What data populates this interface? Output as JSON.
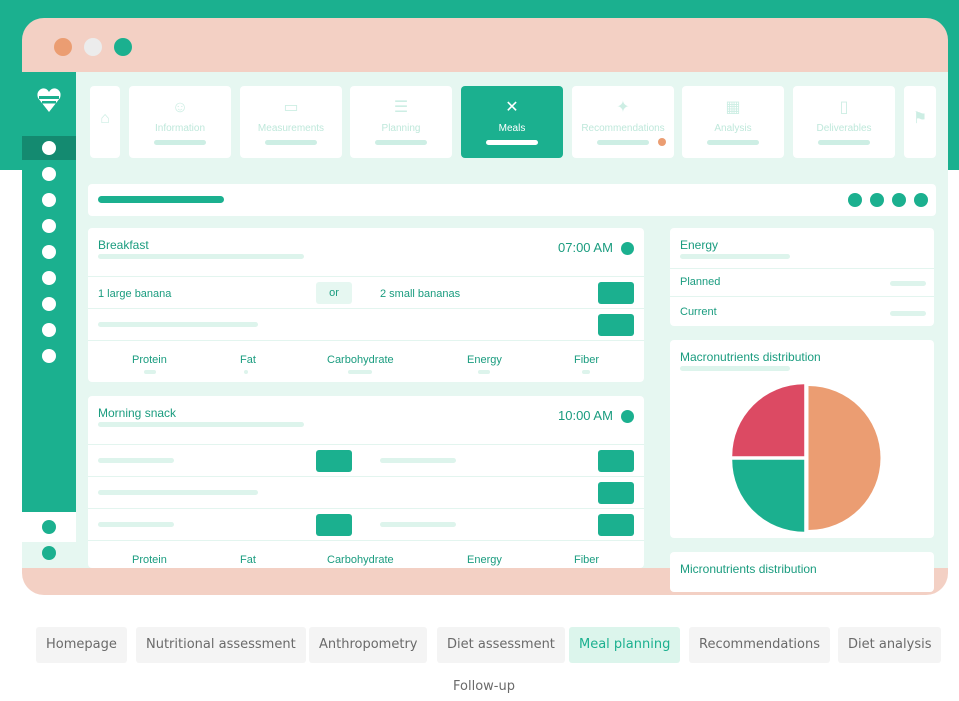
{
  "colors": {
    "accent": "#1bb08f",
    "window_bg": "#f3d0c4",
    "inner_bg": "#e6f7f1",
    "dot_orange": "#eb9d72",
    "dot_gray": "#ececec",
    "pie_red": "#dc4a63",
    "pie_orange": "#eb9d72",
    "pie_green": "#1bb08f"
  },
  "tabs": [
    {
      "label": "Information",
      "icon": "face-icon",
      "active": false
    },
    {
      "label": "Measurements",
      "icon": "ruler-icon",
      "active": false
    },
    {
      "label": "Planning",
      "icon": "sliders-icon",
      "active": false
    },
    {
      "label": "Meals",
      "icon": "fork-knife-icon",
      "active": true
    },
    {
      "label": "Recommendations",
      "icon": "runner-icon",
      "active": false
    },
    {
      "label": "Analysis",
      "icon": "grid-icon",
      "active": false
    },
    {
      "label": "Deliverables",
      "icon": "phone-icon",
      "active": false
    }
  ],
  "breakfast": {
    "title": "Breakfast",
    "time": "07:00 AM",
    "option_a": "1 large banana",
    "or_label": "or",
    "option_b": "2 small bananas"
  },
  "snack": {
    "title": "Morning snack",
    "time": "10:00 AM"
  },
  "nutrients": [
    "Protein",
    "Fat",
    "Carbohydrate",
    "Energy",
    "Fiber"
  ],
  "energy": {
    "title": "Energy",
    "planned": "Planned",
    "current": "Current"
  },
  "macro": {
    "title": "Macronutrients distribution",
    "slices": [
      {
        "label": "red",
        "value": 25
      },
      {
        "label": "orange",
        "value": 50
      },
      {
        "label": "green",
        "value": 25
      }
    ]
  },
  "micro": {
    "title": "Micronutrients distribution"
  },
  "nav": [
    {
      "label": "Homepage",
      "active": false
    },
    {
      "label": "Nutritional assessment",
      "active": false
    },
    {
      "label": "Anthropometry",
      "active": false
    },
    {
      "label": "Diet assessment",
      "active": false
    },
    {
      "label": "Meal planning",
      "active": true
    },
    {
      "label": "Recommendations",
      "active": false
    },
    {
      "label": "Diet analysis",
      "active": false
    },
    {
      "label": "Follow-up",
      "active": false
    }
  ]
}
